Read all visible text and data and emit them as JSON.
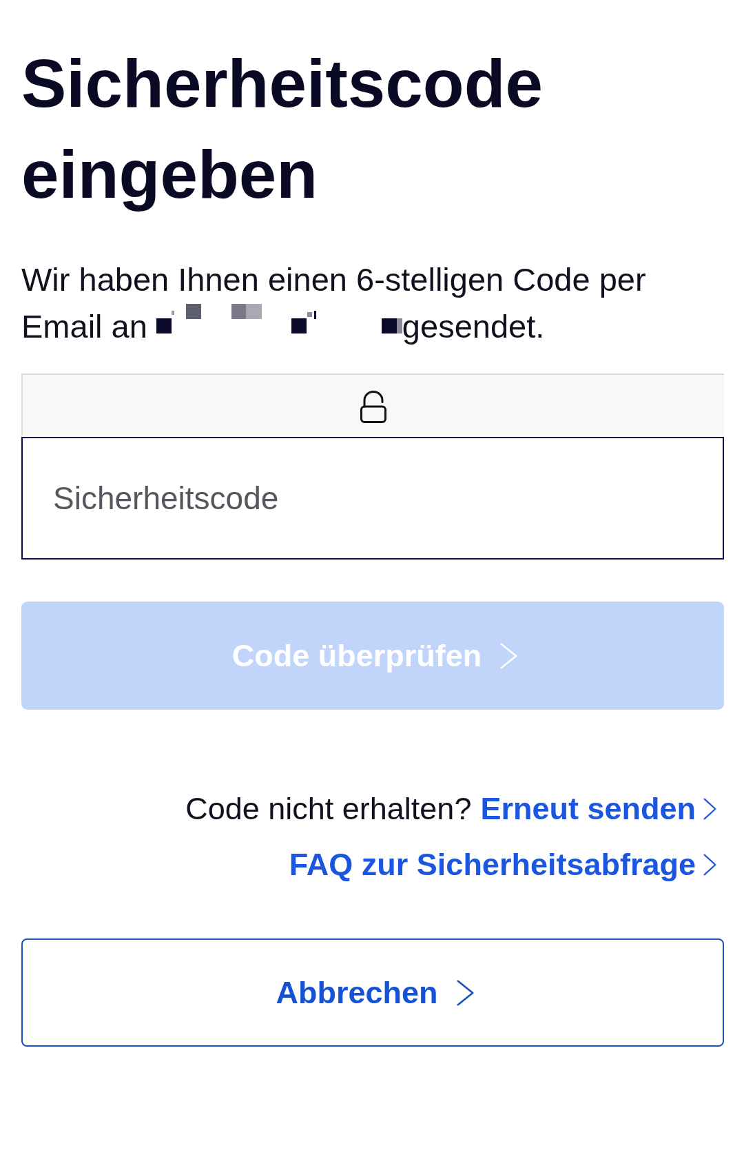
{
  "title": "Sicherheitscode eingeben",
  "message": {
    "text_before": "Wir haben Ihnen einen 6-stelligen Code per Email an",
    "email_redacted": true,
    "text_after": "gesendet."
  },
  "code_field": {
    "placeholder": "Sicherheitscode"
  },
  "verify_button": {
    "label": "Code überprüfen",
    "disabled": true
  },
  "resend": {
    "prompt": "Code nicht erhalten?",
    "link": "Erneut senden"
  },
  "faq_link": "FAQ zur Sicherheitsabfrage",
  "cancel_button": {
    "label": "Abbrechen"
  }
}
